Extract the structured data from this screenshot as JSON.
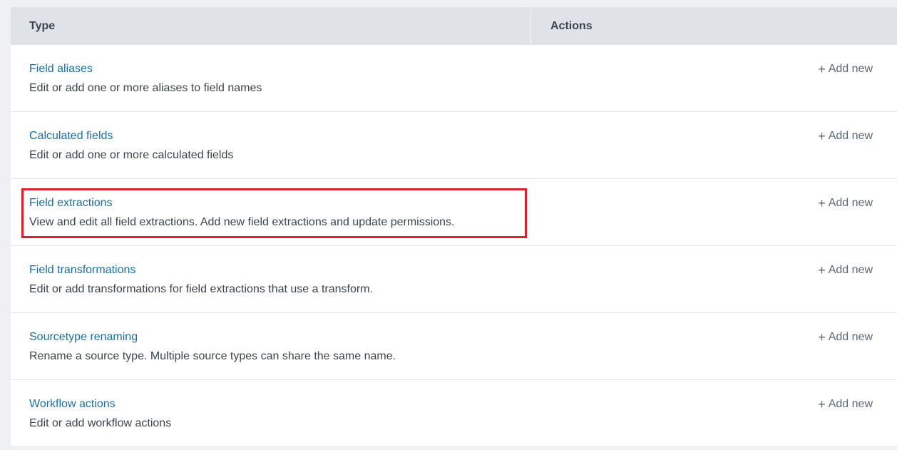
{
  "table": {
    "headers": {
      "type": "Type",
      "actions": "Actions"
    },
    "rows": [
      {
        "title": "Field aliases",
        "description": "Edit or add one or more aliases to field names",
        "action": "Add new"
      },
      {
        "title": "Calculated fields",
        "description": "Edit or add one or more calculated fields",
        "action": "Add new"
      },
      {
        "title": "Field extractions",
        "description": "View and edit all field extractions. Add new field extractions and update permissions.",
        "action": "Add new"
      },
      {
        "title": "Field transformations",
        "description": "Edit or add transformations for field extractions that use a transform.",
        "action": "Add new"
      },
      {
        "title": "Sourcetype renaming",
        "description": "Rename a source type. Multiple source types can share the same name.",
        "action": "Add new"
      },
      {
        "title": "Workflow actions",
        "description": "Edit or add workflow actions",
        "action": "Add new"
      }
    ]
  },
  "icons": {
    "add": "plus-icon"
  },
  "colors": {
    "link": "#1b6fa3",
    "header_bg": "#dfe3e8",
    "highlight": "#d9222a"
  }
}
